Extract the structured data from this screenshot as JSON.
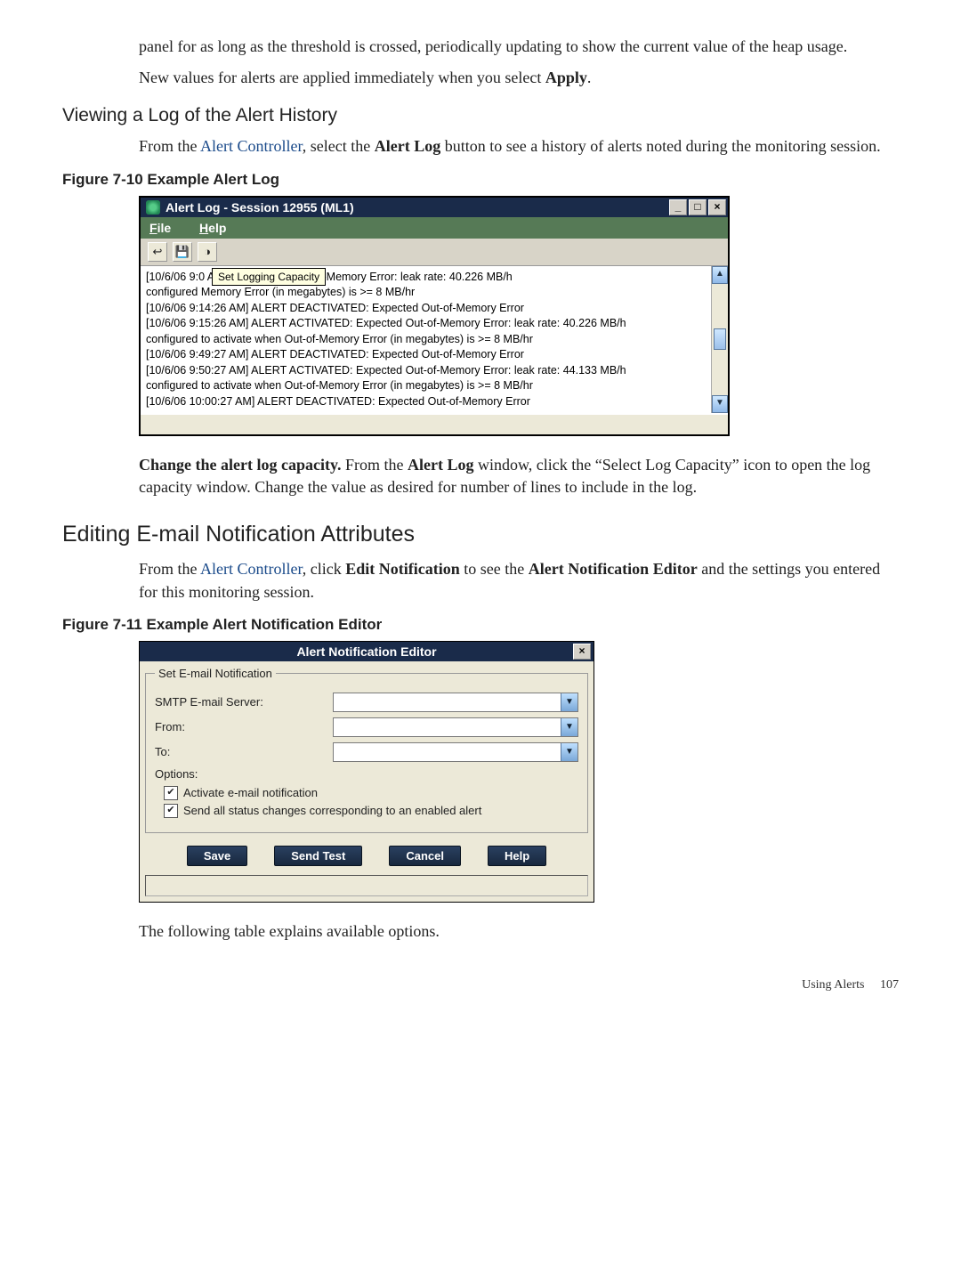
{
  "para1": "panel for as long as the threshold is crossed, periodically updating to show the current value of the heap usage.",
  "para2_a": "New values for alerts are applied immediately when you select ",
  "para2_b": "Apply",
  "para2_c": ".",
  "heading_viewlog": "Viewing a Log of the Alert History",
  "viewlog_a": "From the ",
  "viewlog_link": "Alert Controller",
  "viewlog_b": ", select the ",
  "viewlog_bold": "Alert Log",
  "viewlog_c": " button to see a history of alerts noted during the monitoring session.",
  "fig1_caption": "Figure 7-10 Example Alert Log",
  "alertlog": {
    "title": "Alert Log - Session 12955 (ML1)",
    "menu_file": "File",
    "menu_help": "Help",
    "tooltip": "Set Logging Capacity",
    "lines": [
      "[10/6/06 9:0                                     ATED: Expected Out-of-Memory Error: leak rate: 40.226 MB/h",
      "configured                                        Memory Error (in megabytes) is >= 8 MB/hr",
      "[10/6/06 9:14:26 AM] ALERT DEACTIVATED: Expected Out-of-Memory Error",
      "[10/6/06 9:15:26 AM] ALERT ACTIVATED: Expected Out-of-Memory Error: leak rate: 40.226 MB/h",
      "configured to activate when Out-of-Memory Error (in megabytes) is >= 8 MB/hr",
      "[10/6/06 9:49:27 AM] ALERT DEACTIVATED: Expected Out-of-Memory Error",
      "[10/6/06 9:50:27 AM] ALERT ACTIVATED: Expected Out-of-Memory Error: leak rate: 44.133 MB/h",
      "configured to activate when Out-of-Memory Error (in megabytes) is >= 8 MB/hr",
      "[10/6/06 10:00:27 AM] ALERT DEACTIVATED: Expected Out-of-Memory Error"
    ]
  },
  "change_cap_bold": "Change the alert log capacity.",
  "change_cap_a": "    From the ",
  "change_cap_b": "Alert Log",
  "change_cap_c": " window, click the “Select Log Capacity” icon to open the log capacity window. Change the value as desired for number of lines to include in the log.",
  "heading_email": "Editing E-mail Notification Attributes",
  "email_a": "From the ",
  "email_link": "Alert Controller",
  "email_b": ", click ",
  "email_bold1": "Edit Notification",
  "email_c": " to see the ",
  "email_bold2": "Alert Notification Editor",
  "email_d": " and the settings you entered for this monitoring session.",
  "fig2_caption": "Figure 7-11 Example Alert Notification Editor",
  "editor": {
    "title": "Alert Notification Editor",
    "legend": "Set E-mail Notification",
    "lbl_smtp": "SMTP E-mail Server:",
    "lbl_from": "From:",
    "lbl_to": "To:",
    "lbl_options": "Options:",
    "cb1": "Activate e-mail notification",
    "cb2": "Send all status changes corresponding to an enabled alert",
    "btn_save": "Save",
    "btn_sendtest": "Send Test",
    "btn_cancel": "Cancel",
    "btn_help": "Help"
  },
  "closing": "The following table explains available options.",
  "footer_text": "Using Alerts",
  "footer_page": "107"
}
